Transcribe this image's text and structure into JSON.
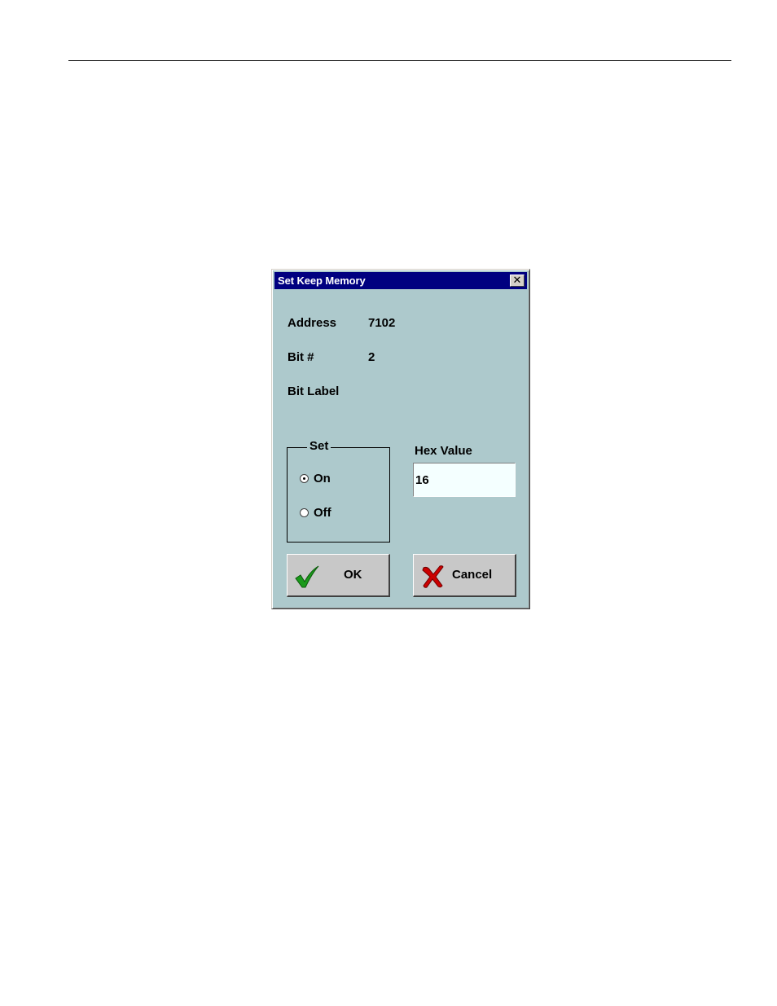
{
  "dialog": {
    "title": "Set Keep Memory",
    "close_symbol": "✕",
    "fields": [
      {
        "label": "Address",
        "value": "7102"
      },
      {
        "label": "Bit #",
        "value": "2"
      },
      {
        "label": "Bit Label",
        "value": ""
      }
    ],
    "set_group": {
      "legend": "Set",
      "options": [
        {
          "label": "On",
          "checked": true
        },
        {
          "label": "Off",
          "checked": false
        }
      ]
    },
    "hex": {
      "label": "Hex Value",
      "value": "16"
    },
    "buttons": {
      "ok": {
        "label": "OK",
        "icon": "checkmark-icon",
        "icon_color": "#1a9a1a"
      },
      "cancel": {
        "label": "Cancel",
        "icon": "x-mark-icon",
        "icon_color": "#cc0000"
      }
    },
    "colors": {
      "title_bar": "#000080",
      "dialog_bg": "#adc9cc"
    }
  }
}
